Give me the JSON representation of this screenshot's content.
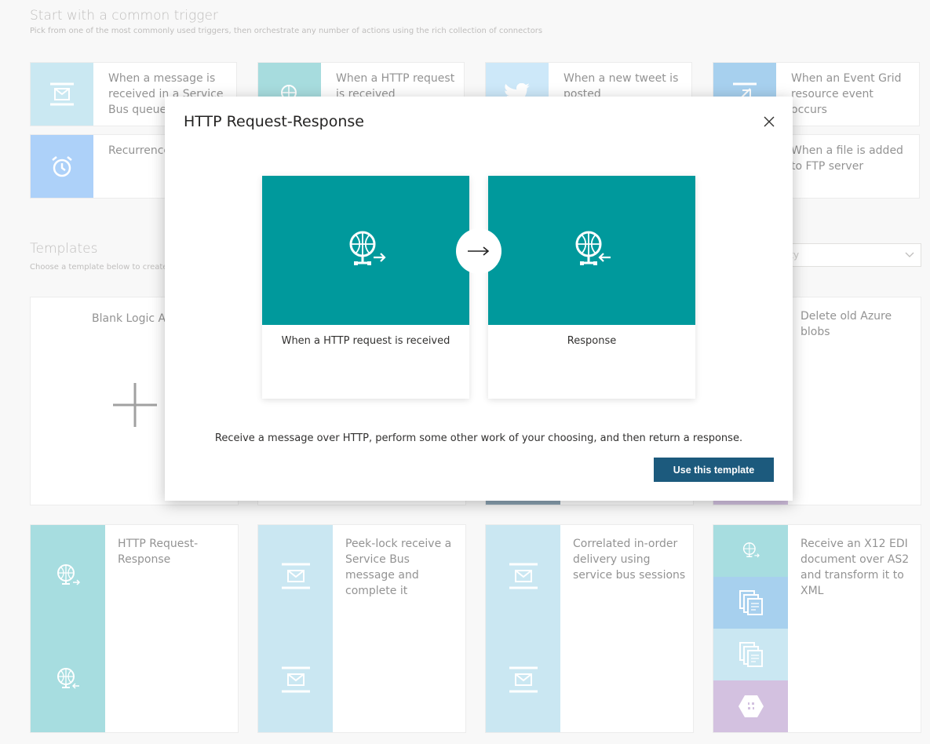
{
  "triggers": {
    "title": "Start with a common trigger",
    "subtitle": "Pick from one of the most commonly used triggers, then orchestrate any number of actions using the rich collection of connectors",
    "cards": [
      {
        "label": "When a message is received in a Service Bus queue",
        "icon": "service-bus-icon",
        "color": "#9fd5e8"
      },
      {
        "label": "When a HTTP request is received",
        "icon": "http-globe-icon",
        "color": "#5fbfc3"
      },
      {
        "label": "When a new tweet is posted",
        "icon": "twitter-icon",
        "color": "#a5d5f5"
      },
      {
        "label": "When an Event Grid resource event occurs",
        "icon": "event-grid-icon",
        "color": "#5fa9e0"
      },
      {
        "label": "Recurrence",
        "icon": "alarm-clock-icon",
        "color": "#6aabf5"
      },
      {
        "label": "When a file is added to FTP server",
        "icon": "ftp-icon",
        "color": "#aaaaaa"
      }
    ]
  },
  "templates": {
    "title": "Templates",
    "subtitle": "Choose a template below to create",
    "filter_value": "ity",
    "blank_label": "Blank Logic App",
    "delete_blobs_label": "Delete old Azure blobs",
    "cards": [
      {
        "label": "HTTP Request-Response"
      },
      {
        "label": "Peek-lock receive a Service Bus message and complete it"
      },
      {
        "label": "Correlated in-order delivery using service bus sessions"
      },
      {
        "label": "Receive an X12 EDI document over AS2 and transform it to XML"
      }
    ]
  },
  "modal": {
    "title": "HTTP Request-Response",
    "step1_label": "When a HTTP request is received",
    "step2_label": "Response",
    "description": "Receive a message over HTTP, perform some other work of your choosing, and then return a response.",
    "use_button": "Use this template"
  },
  "colors": {
    "http_teal": "#00999c",
    "http_light": "#5fc2c6",
    "servicebus_light": "#9fd4e8",
    "button_blue": "#1c5a7d",
    "edi_blue": "#5fa9e0",
    "edi_purple": "#b08fc7"
  }
}
